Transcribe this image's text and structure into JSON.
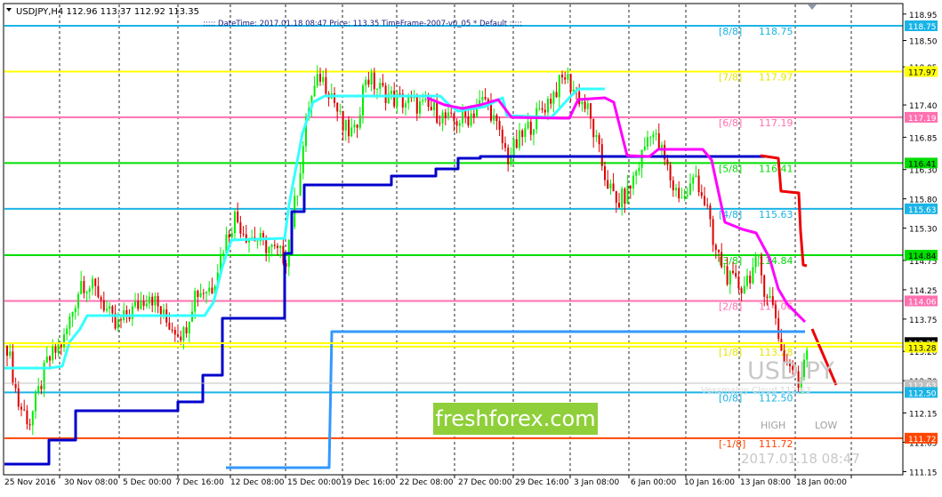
{
  "header": {
    "symbol_info": "USDJPY,H4  112.96 113.37 112.92 113.35",
    "indicator_info": ":::::  DateTime: 2017.01.18 08:47    Price: 113.35    TimeFrame-2007-v0_05      *    Default   :::::"
  },
  "murrey_levels": [
    {
      "label": "[8/8]",
      "value": "118.75",
      "price": 118.75,
      "color": "#1ab4e6",
      "label_color": "#1ab4e6"
    },
    {
      "label": "[7/8]",
      "value": "117.97",
      "price": 117.97,
      "color": "#ffff00",
      "label_color": "#e6e600"
    },
    {
      "label": "[6/8]",
      "value": "117.19",
      "price": 117.19,
      "color": "#ff70b0",
      "label_color": "#ff70b0"
    },
    {
      "label": "[5/8]",
      "value": "116.41",
      "price": 116.41,
      "color": "#00dd00",
      "label_color": "#00dd00"
    },
    {
      "label": "[4/8]",
      "value": "115.63",
      "price": 115.63,
      "color": "#1ab4e6",
      "label_color": "#1ab4e6"
    },
    {
      "label": "[3/8]",
      "value": "114.84",
      "price": 114.84,
      "color": "#00dd00",
      "label_color": "#00dd00"
    },
    {
      "label": "[2/8]",
      "value": "114.06",
      "price": 114.06,
      "color": "#ff70b0",
      "label_color": "#ff70b0"
    },
    {
      "label": "[1/8]",
      "value": "113.28",
      "price": 113.28,
      "color": "#ffff00",
      "label_color": "#e6e600"
    },
    {
      "label": "[0/8]",
      "value": "112.50",
      "price": 112.5,
      "color": "#1ab4e6",
      "label_color": "#1ab4e6"
    },
    {
      "label": "[-1/8]",
      "value": "111.72",
      "price": 111.72,
      "color": "#ff4500",
      "label_color": "#ff4500"
    }
  ],
  "price_axis": {
    "ticks": [
      "118.95",
      "118.50",
      "118.05",
      "117.40",
      "116.85",
      "116.30",
      "115.80",
      "115.30",
      "114.75",
      "114.25",
      "113.75",
      "113.20",
      "112.70",
      "112.15",
      "111.65",
      "111.15"
    ],
    "markers": [
      {
        "text": "118.75",
        "bg": "#1ab4e6",
        "fg": "#ffffff",
        "price": 118.75
      },
      {
        "text": "117.97",
        "bg": "#ffff00",
        "fg": "#000000",
        "price": 117.97
      },
      {
        "text": "117.19",
        "bg": "#ff70b0",
        "fg": "#ffffff",
        "price": 117.19
      },
      {
        "text": "116.41",
        "bg": "#00dd00",
        "fg": "#000000",
        "price": 116.41
      },
      {
        "text": "115.63",
        "bg": "#1ab4e6",
        "fg": "#ffffff",
        "price": 115.63
      },
      {
        "text": "114.84",
        "bg": "#00dd00",
        "fg": "#000000",
        "price": 114.84
      },
      {
        "text": "114.06",
        "bg": "#ff70b0",
        "fg": "#ffffff",
        "price": 114.06
      },
      {
        "text": "113.35",
        "bg": "#000000",
        "fg": "#ffffff",
        "price": 113.35
      },
      {
        "text": "113.28",
        "bg": "#ffff00",
        "fg": "#000000",
        "price": 113.27
      },
      {
        "text": "112.63",
        "bg": "#c0c0c0",
        "fg": "#ffffff",
        "price": 112.63
      },
      {
        "text": "112.50",
        "bg": "#1ab4e6",
        "fg": "#ffffff",
        "price": 112.5
      },
      {
        "text": "111.72",
        "bg": "#ff4500",
        "fg": "#ffffff",
        "price": 111.72
      }
    ]
  },
  "time_axis": {
    "labels": [
      "25 Nov 2016",
      "30 Nov 08:00",
      "5 Dec 00:00",
      "7 Dec 16:00",
      "12 Dec 08:00",
      "15 Dec 00:00",
      "19 Dec 16:00",
      "22 Dec 08:00",
      "27 Dec 00:00",
      "29 Dec 16:00",
      "3 Jan 08:00",
      "6 Jan 00:00",
      "10 Jan 16:00",
      "13 Jan 08:00",
      "18 Jan 00:00"
    ]
  },
  "overlay": {
    "symbol_watermark": "USDJPY",
    "symbol_sub": "Vexsmaloy Cloud 112.63",
    "high_label": "HIGH",
    "low_label": "LOW",
    "datetime": "2017.01.18 08:47",
    "brand": "freshforex.com"
  },
  "colors": {
    "bull": "#00ee00",
    "bear": "#dd0000",
    "cyan_line": "#33ffff",
    "navy_line": "#0000cc",
    "magenta_line": "#ff00ff",
    "red_line": "#ee0000",
    "blue_line": "#3399ff"
  },
  "chart_data": {
    "type": "candlestick",
    "symbol": "USDJPY",
    "timeframe": "H4",
    "ylim": [
      111.15,
      119.0
    ],
    "last_price": 113.35,
    "ohlc_last": {
      "open": 112.96,
      "high": 113.37,
      "low": 112.92,
      "close": 113.35
    },
    "levels": [
      118.75,
      117.97,
      117.19,
      116.41,
      115.63,
      114.84,
      114.06,
      113.28,
      112.5,
      111.72
    ]
  }
}
